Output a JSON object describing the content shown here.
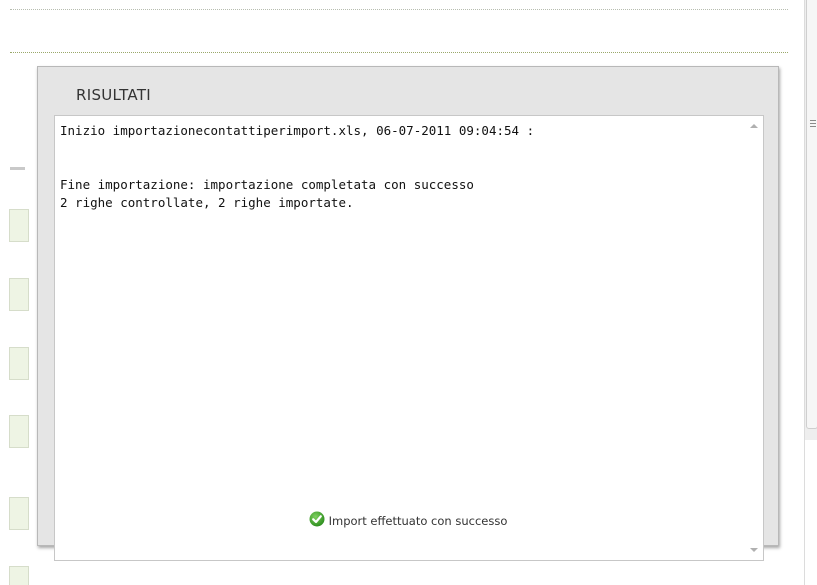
{
  "dialog": {
    "title": "RISULTATI",
    "log_lines": [
      "Inizio importazionecontattiperimport.xls, 06-07-2011 09:04:54 :",
      "",
      "",
      "Fine importazione: importazione completata con successo",
      "2 righe controllate, 2 righe importate."
    ],
    "status_icon": "check-circle-icon",
    "status_text": "Import effettuato con successo"
  },
  "colors": {
    "success_green": "#3aa12a",
    "cell_green": "#eef4e4",
    "dialog_bg": "#e5e5e5"
  }
}
